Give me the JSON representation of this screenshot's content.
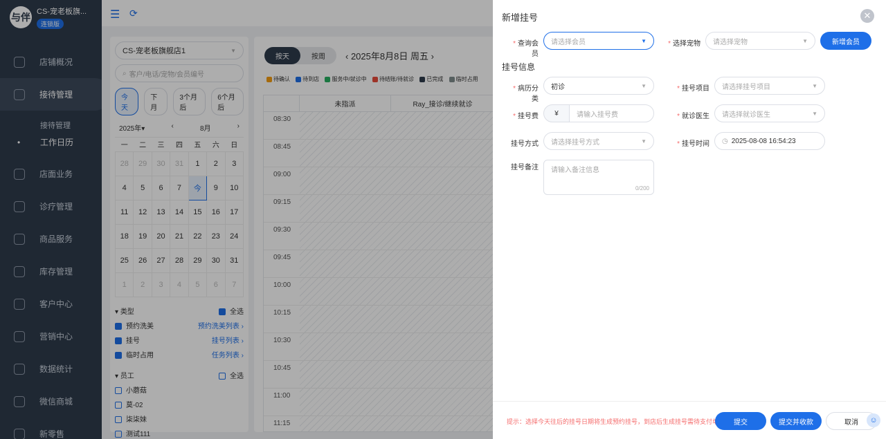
{
  "sidebar": {
    "logo_text": "与伴",
    "shop_name": "CS-宠老板旗...",
    "edition": "连锁版",
    "items": [
      {
        "label": "店铺概况"
      },
      {
        "label": "接待管理"
      },
      {
        "label": "店面业务"
      },
      {
        "label": "诊疗管理"
      },
      {
        "label": "商品服务"
      },
      {
        "label": "库存管理"
      },
      {
        "label": "客户中心"
      },
      {
        "label": "营销中心"
      },
      {
        "label": "数据统计"
      },
      {
        "label": "微信商城"
      },
      {
        "label": "新零售"
      }
    ],
    "subitems": [
      {
        "label": "接待管理"
      },
      {
        "label": "工作日历"
      }
    ]
  },
  "left_panel": {
    "store_select": "CS-宠老板旗舰店1",
    "search_placeholder": "客户/电话/宠物/会员编号",
    "quick": [
      "今天",
      "下月",
      "3个月后",
      "6个月后"
    ],
    "year": "2025年",
    "month": "8月",
    "weekdays": [
      "一",
      "二",
      "三",
      "四",
      "五",
      "六",
      "日"
    ],
    "weeks": [
      [
        "28",
        "29",
        "30",
        "31",
        "1",
        "2",
        "3"
      ],
      [
        "4",
        "5",
        "6",
        "7",
        "今",
        "9",
        "10"
      ],
      [
        "11",
        "12",
        "13",
        "14",
        "15",
        "16",
        "17"
      ],
      [
        "18",
        "19",
        "20",
        "21",
        "22",
        "23",
        "24"
      ],
      [
        "25",
        "26",
        "27",
        "28",
        "29",
        "30",
        "31"
      ],
      [
        "1",
        "2",
        "3",
        "4",
        "5",
        "6",
        "7"
      ]
    ],
    "type_group": {
      "title": "类型",
      "all": "全选",
      "items": [
        {
          "label": "预约洗美",
          "link": "预约洗美列表"
        },
        {
          "label": "挂号",
          "link": "挂号列表"
        },
        {
          "label": "临时占用",
          "link": "任务列表"
        }
      ]
    },
    "staff_group": {
      "title": "员工",
      "all": "全选",
      "items": [
        "小蘑菇",
        "莫-02",
        "柒柒妹",
        "测试111"
      ]
    }
  },
  "schedule": {
    "view_day": "按天",
    "view_week": "按周",
    "date_title": "2025年8月8日 周五",
    "legend": [
      {
        "label": "待确认",
        "color": "#f39c12"
      },
      {
        "label": "待到店",
        "color": "#1e6fe8"
      },
      {
        "label": "服务中/就诊中",
        "color": "#27ae60"
      },
      {
        "label": "待结账/待就诊",
        "color": "#e74c3c"
      },
      {
        "label": "已完成",
        "color": "#2f3b4c"
      },
      {
        "label": "临时占用",
        "color": "#7f8c8d"
      }
    ],
    "columns": [
      "未指派",
      "Ray_接诊/继续就诊"
    ],
    "times": [
      "08:30",
      "08:45",
      "09:00",
      "09:15",
      "09:30",
      "09:45",
      "10:00",
      "10:15",
      "10:30",
      "10:45",
      "11:00",
      "11:15"
    ]
  },
  "drawer": {
    "title": "新增挂号",
    "member_label": "查询会员",
    "member_placeholder": "请选择会员",
    "pet_label": "选择宠物",
    "pet_placeholder": "请选择宠物",
    "add_member": "新增会员",
    "section": "挂号信息",
    "case_label": "病历分类",
    "case_value": "初诊",
    "item_label": "挂号项目",
    "item_placeholder": "请选择挂号项目",
    "fee_label": "挂号费",
    "fee_prefix": "¥",
    "fee_placeholder": "请输入挂号费",
    "doctor_label": "就诊医生",
    "doctor_placeholder": "请选择就诊医生",
    "method_label": "挂号方式",
    "method_placeholder": "请选择挂号方式",
    "time_label": "挂号时间",
    "time_value": "2025-08-08 16:54:23",
    "note_label": "挂号备注",
    "note_placeholder": "请输入备注信息",
    "note_count": "0/200",
    "tip": "提示：选择今天往后的挂号日期将生成预约挂号，到店后生成挂号需待支付单据",
    "submit": "提交",
    "submit_pay": "提交并收款",
    "cancel": "取消"
  }
}
